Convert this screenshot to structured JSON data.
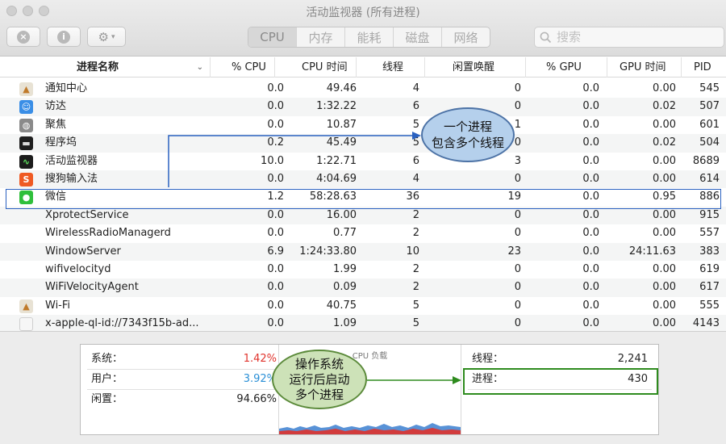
{
  "window": {
    "title": "活动监视器 (所有进程)"
  },
  "toolbar": {
    "stop_icon": "close-circle-icon",
    "info_label": "i",
    "gear_label": "⚙",
    "tabs": [
      "CPU",
      "内存",
      "能耗",
      "磁盘",
      "网络"
    ],
    "active_tab": "CPU",
    "search_placeholder": "搜索"
  },
  "table": {
    "columns": [
      "进程名称",
      "% CPU",
      "CPU 时间",
      "线程",
      "闲置唤醒",
      "% GPU",
      "GPU 时间",
      "PID"
    ],
    "rows": [
      {
        "name": "通知中心",
        "icon": "notification-center-icon",
        "cpu": "0.0",
        "cpu_time": "49.46",
        "threads": "4",
        "idle_wakeups": "0",
        "gpu": "0.0",
        "gpu_time": "0.00",
        "pid": "545"
      },
      {
        "name": "访达",
        "icon": "finder-icon",
        "cpu": "0.0",
        "cpu_time": "1:32.22",
        "threads": "6",
        "idle_wakeups": "0",
        "gpu": "0.0",
        "gpu_time": "0.02",
        "pid": "507"
      },
      {
        "name": "聚焦",
        "icon": "spotlight-icon",
        "cpu": "0.0",
        "cpu_time": "10.87",
        "threads": "5",
        "idle_wakeups": "1",
        "gpu": "0.0",
        "gpu_time": "0.00",
        "pid": "601"
      },
      {
        "name": "程序坞",
        "icon": "dock-icon",
        "cpu": "0.2",
        "cpu_time": "45.49",
        "threads": "5",
        "idle_wakeups": "0",
        "gpu": "0.0",
        "gpu_time": "0.02",
        "pid": "504"
      },
      {
        "name": "活动监视器",
        "icon": "activity-monitor-icon",
        "cpu": "10.0",
        "cpu_time": "1:22.71",
        "threads": "6",
        "idle_wakeups": "3",
        "gpu": "0.0",
        "gpu_time": "0.00",
        "pid": "8689"
      },
      {
        "name": "搜狗输入法",
        "icon": "sogou-input-icon",
        "cpu": "0.0",
        "cpu_time": "4:04.69",
        "threads": "4",
        "idle_wakeups": "0",
        "gpu": "0.0",
        "gpu_time": "0.00",
        "pid": "614"
      },
      {
        "name": "微信",
        "icon": "wechat-icon",
        "cpu": "1.2",
        "cpu_time": "58:28.63",
        "threads": "36",
        "idle_wakeups": "19",
        "gpu": "0.0",
        "gpu_time": "0.95",
        "pid": "886"
      },
      {
        "name": "XprotectService",
        "icon": "",
        "cpu": "0.0",
        "cpu_time": "16.00",
        "threads": "2",
        "idle_wakeups": "0",
        "gpu": "0.0",
        "gpu_time": "0.00",
        "pid": "915"
      },
      {
        "name": "WirelessRadioManagerd",
        "icon": "",
        "cpu": "0.0",
        "cpu_time": "0.77",
        "threads": "2",
        "idle_wakeups": "0",
        "gpu": "0.0",
        "gpu_time": "0.00",
        "pid": "557"
      },
      {
        "name": "WindowServer",
        "icon": "",
        "cpu": "6.9",
        "cpu_time": "1:24:33.80",
        "threads": "10",
        "idle_wakeups": "23",
        "gpu": "0.0",
        "gpu_time": "24:11.63",
        "pid": "383"
      },
      {
        "name": "wifivelocityd",
        "icon": "",
        "cpu": "0.0",
        "cpu_time": "1.99",
        "threads": "2",
        "idle_wakeups": "0",
        "gpu": "0.0",
        "gpu_time": "0.00",
        "pid": "619"
      },
      {
        "name": "WiFiVelocityAgent",
        "icon": "",
        "cpu": "0.0",
        "cpu_time": "0.09",
        "threads": "2",
        "idle_wakeups": "0",
        "gpu": "0.0",
        "gpu_time": "0.00",
        "pid": "617"
      },
      {
        "name": "Wi-Fi",
        "icon": "wifi-app-icon",
        "cpu": "0.0",
        "cpu_time": "40.75",
        "threads": "5",
        "idle_wakeups": "0",
        "gpu": "0.0",
        "gpu_time": "0.00",
        "pid": "555"
      },
      {
        "name": "x-apple-ql-id://7343f15b-ad...",
        "icon": "document-icon",
        "cpu": "0.0",
        "cpu_time": "1.09",
        "threads": "5",
        "idle_wakeups": "0",
        "gpu": "0.0",
        "gpu_time": "0.00",
        "pid": "4143"
      }
    ]
  },
  "stats": {
    "system_label": "系统：",
    "system_value": "1.42%",
    "system_color": "#e0322b",
    "user_label": "用户：",
    "user_value": "3.92%",
    "user_color": "#2a8fd6",
    "idle_label": "闲置：",
    "idle_value": "94.66%",
    "graph_title": "CPU 负载",
    "threads_label": "线程：",
    "threads_value": "2,241",
    "processes_label": "进程：",
    "processes_value": "430"
  },
  "annotations": {
    "blue_bubble_line1": "一个进程",
    "blue_bubble_line2": "包含多个线程",
    "green_bubble_line1": "操作系统",
    "green_bubble_line2": "运行后启动",
    "green_bubble_line3": "多个进程"
  }
}
